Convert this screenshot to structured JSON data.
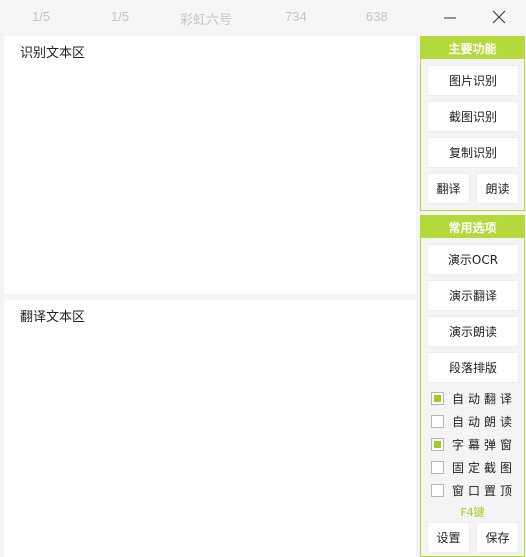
{
  "titlebar": {
    "items": [
      "1/5",
      "1/5",
      "彩虹六号",
      "734",
      "638"
    ],
    "minimize_glyph": "—",
    "close_glyph": "✕"
  },
  "recognize_area": {
    "title": "识别文本区"
  },
  "translate_area": {
    "title": "翻译文本区"
  },
  "main_functions": {
    "header": "主要功能",
    "image_recognize": "图片识别",
    "screenshot_recognize": "截图识别",
    "copy_recognize": "复制识别",
    "translate": "翻译",
    "read_aloud": "朗读"
  },
  "common_options": {
    "header": "常用选项",
    "demo_ocr": "演示OCR",
    "demo_translate": "演示翻译",
    "demo_read": "演示朗读",
    "paragraph_layout": "段落排版",
    "checkboxes": [
      {
        "label": "自动翻译",
        "checked": true
      },
      {
        "label": "自动朗读",
        "checked": false
      },
      {
        "label": "字幕弹窗",
        "checked": true
      },
      {
        "label": "固定截图",
        "checked": false
      },
      {
        "label": "窗口置顶",
        "checked": false
      }
    ],
    "hotkey_hint": "F4键",
    "settings": "设置",
    "save": "保存"
  },
  "colors": {
    "accent": "#b3d93a",
    "check": "#9ccc1e"
  },
  "icons": {
    "minimize": "minimize-icon",
    "close": "close-icon"
  }
}
